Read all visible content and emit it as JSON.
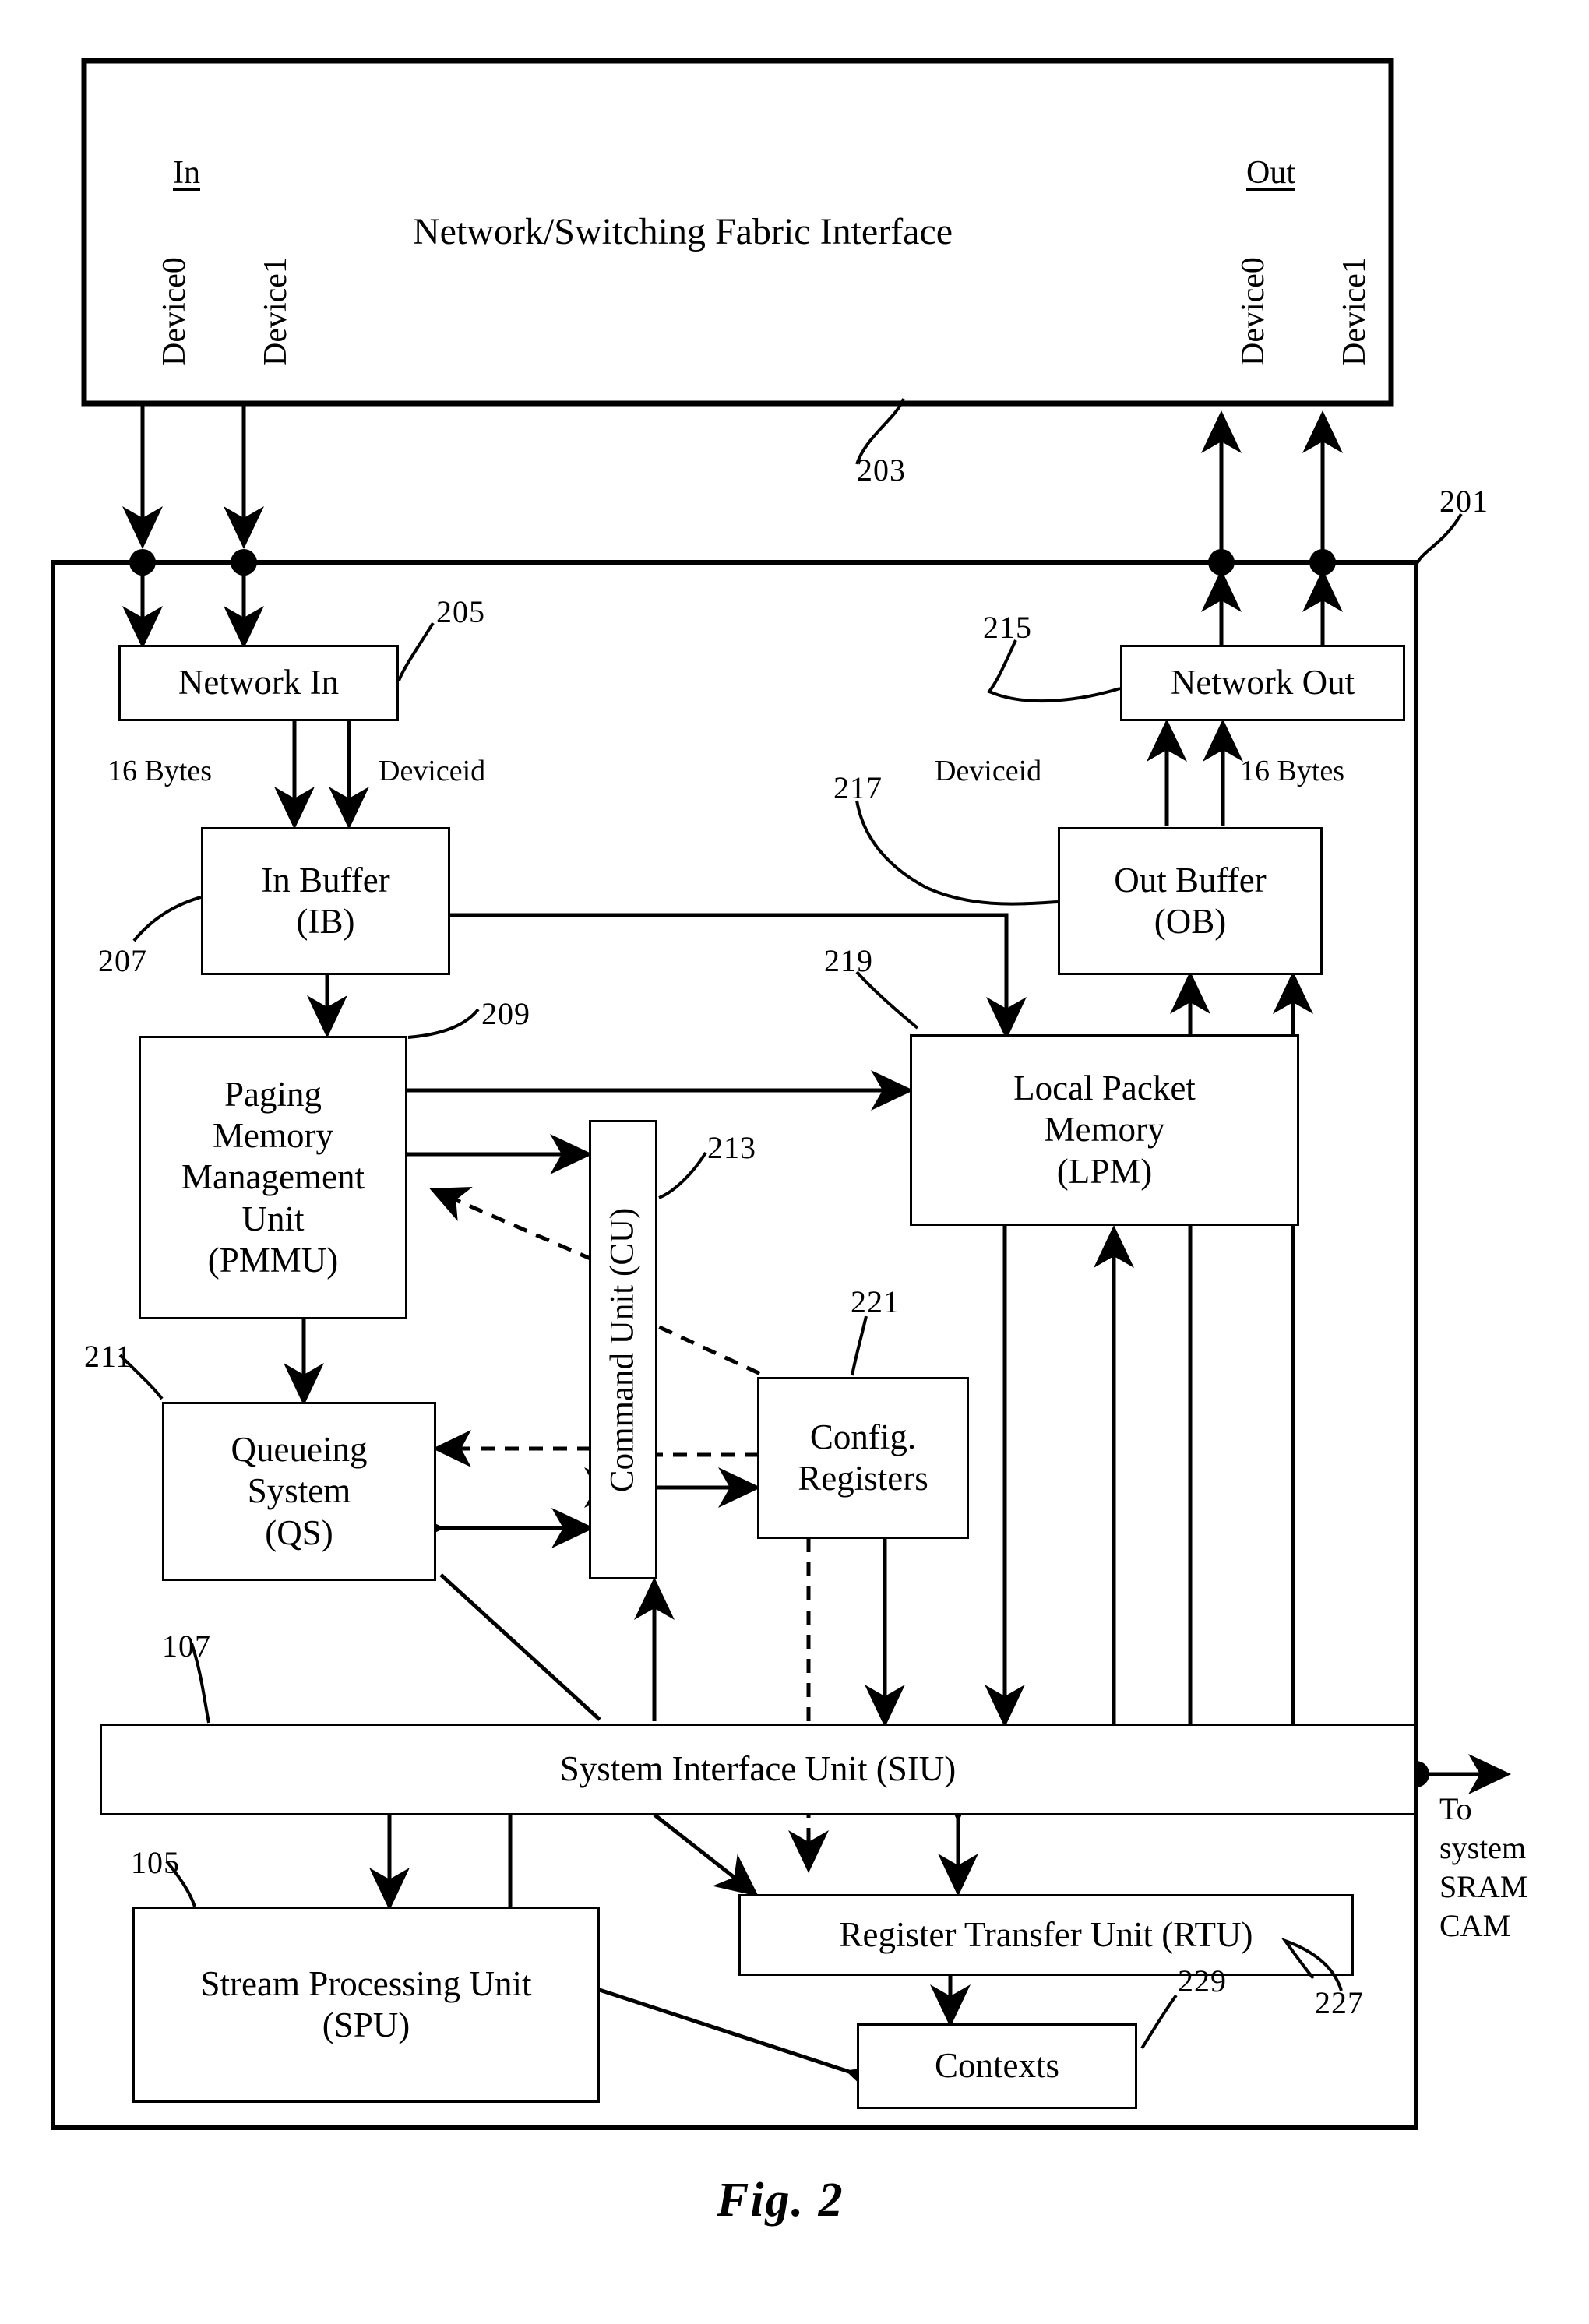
{
  "figure": {
    "caption": "Fig. 2",
    "title_box": "Network/Switching Fabric Interface"
  },
  "ports": {
    "in_label": "In",
    "out_label": "Out",
    "in_device0": "Device0",
    "in_device1": "Device1",
    "out_device0": "Device0",
    "out_device1": "Device1"
  },
  "blocks": {
    "fabric": {
      "label": "Network/Switching Fabric Interface",
      "ref": "203"
    },
    "chip": {
      "ref": "201"
    },
    "network_in": {
      "label": "Network In",
      "ref": "205"
    },
    "network_out": {
      "label": "Network Out",
      "ref": "215"
    },
    "in_buffer": {
      "line1": "In Buffer",
      "line2": "(IB)",
      "ref": "207"
    },
    "out_buffer": {
      "line1": "Out Buffer",
      "line2": "(OB)",
      "ref": "217"
    },
    "pmmu": {
      "line1": "Paging",
      "line2": "Memory",
      "line3": "Management",
      "line4": "Unit",
      "line5": "(PMMU)",
      "ref": "209"
    },
    "qs": {
      "line1": "Queueing",
      "line2": "System",
      "line3": "(QS)",
      "ref": "211"
    },
    "cu": {
      "label": "Command Unit (CU)",
      "ref": "213"
    },
    "lpm": {
      "line1": "Local Packet",
      "line2": "Memory",
      "line3": "(LPM)",
      "ref": "219"
    },
    "cfg": {
      "line1": "Config.",
      "line2": "Registers",
      "ref": "221"
    },
    "siu": {
      "label": "System Interface Unit (SIU)",
      "ref": "107"
    },
    "spu": {
      "line1": "Stream Processing Unit",
      "line2": "(SPU)",
      "ref": "105"
    },
    "rtu": {
      "label": "Register Transfer Unit (RTU)",
      "ref": "227"
    },
    "contexts": {
      "label": "Contexts",
      "ref": "229"
    }
  },
  "signals": {
    "in_16bytes": "16 Bytes",
    "in_deviceid": "Deviceid",
    "out_deviceid": "Deviceid",
    "out_16bytes": "16 Bytes",
    "to_system": "To\nsystem\nSRAM\nCAM"
  }
}
